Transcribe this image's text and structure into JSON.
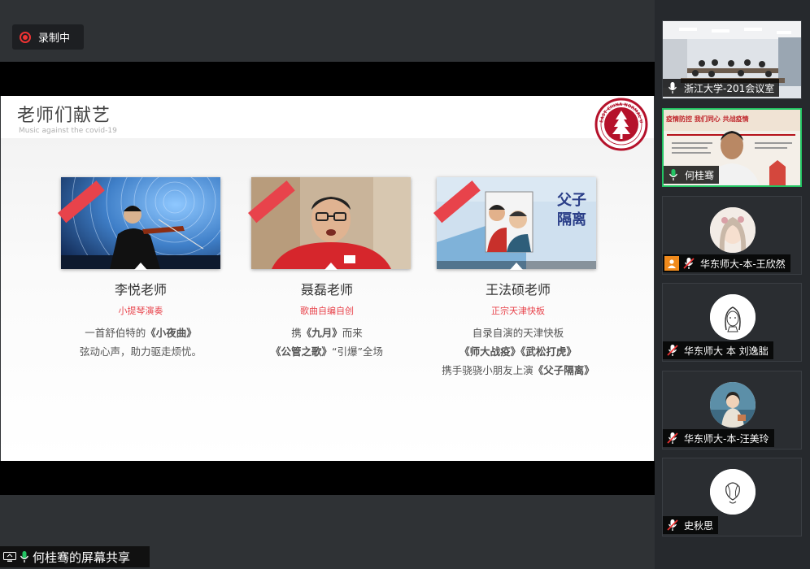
{
  "recording": {
    "label": "录制中",
    "color": "#e33333"
  },
  "slide": {
    "title": "老师们献艺",
    "subtitle": "Music against the covid-19",
    "logo_text": "EAST CHINA NORMAL UNIVERSITY",
    "accent": "#e8434b",
    "cards": [
      {
        "name": "李悦老师",
        "role": "小提琴演奏",
        "lines": [
          [
            {
              "t": "一首舒伯特的",
              "b": false
            },
            {
              "t": "《小夜曲》",
              "b": true
            }
          ],
          [
            {
              "t": "弦动心声，助力驱走烦忧。",
              "b": false
            }
          ]
        ]
      },
      {
        "name": "聂磊老师",
        "role": "歌曲自编自创",
        "lines": [
          [
            {
              "t": "携",
              "b": false
            },
            {
              "t": "《九月》",
              "b": true
            },
            {
              "t": "而来",
              "b": false
            }
          ],
          [
            {
              "t": "《公管之歌》",
              "b": true
            },
            {
              "t": "“引爆”全场",
              "b": false
            }
          ]
        ]
      },
      {
        "name": "王法硕老师",
        "role": "正宗天津快板",
        "lines": [
          [
            {
              "t": "自录自演的天津快板",
              "b": false
            }
          ],
          [
            {
              "t": "《师大战疫》《武松打虎》",
              "b": true
            }
          ],
          [
            {
              "t": "携手骁骁小朋友上演",
              "b": false
            },
            {
              "t": "《父子隔离》",
              "b": true
            }
          ]
        ]
      }
    ],
    "poster_text": "父子隔离"
  },
  "share_bar": {
    "label": "何桂骞的屏幕共享"
  },
  "participants": [
    {
      "name": "浙江大学-201会议室",
      "type": "video"
    },
    {
      "name": "何桂骞",
      "type": "video",
      "active": true,
      "banner": "疫情防控 我们同心 共战疫情"
    },
    {
      "name": "华东师大-本-王欣然",
      "type": "avatar",
      "host": true
    },
    {
      "name": "华东师大 本 刘逸朏",
      "type": "avatar"
    },
    {
      "name": "华东师大-本-汪美玲",
      "type": "avatar"
    },
    {
      "name": "史秋思",
      "type": "avatar"
    }
  ]
}
